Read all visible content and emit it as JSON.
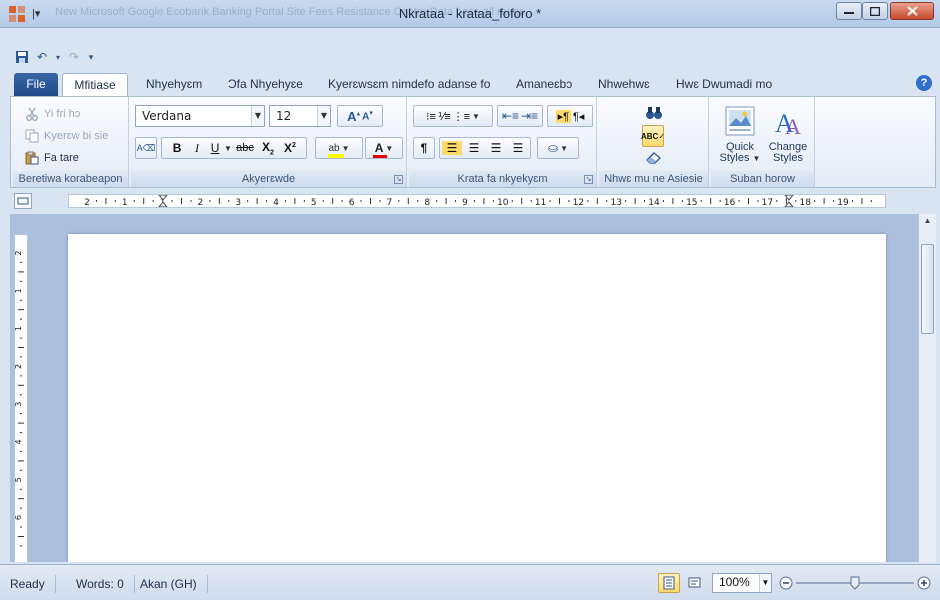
{
  "window": {
    "title": "Nkrataa - krataa_foforo *",
    "background_tabs": "New Microsoft    Google    Ecobank Banking Portal    Site Fees Resistance Centre    Data base all range"
  },
  "tabs": {
    "file": "File",
    "items": [
      "Mfitiase",
      "Nhyehyɛm",
      "Ɔfa Nhyehyɛe",
      "Kyerɛwsɛm nimdefo adanse fo",
      "Amaneɛbɔ",
      "Nhwehwɛ",
      "Hwɛ Dwumadi mo"
    ]
  },
  "clipboard": {
    "cut": "Yi fri hɔ",
    "copy": "Kyerɛw bi sie",
    "paste": "Fa tare",
    "label": "Beretiwa korabeapon"
  },
  "font": {
    "name": "Verdana",
    "size": "12",
    "label": "Akyerɛwde"
  },
  "paragraph": {
    "label": "Krata fa nkyekyɛm"
  },
  "editing": {
    "label": "Nhwɛ mu ne Asiesie"
  },
  "styles": {
    "quick_line1": "Quick",
    "quick_line2": "Styles",
    "change_line1": "Change",
    "change_line2": "Styles",
    "label": "Suban horow"
  },
  "ruler": {
    "horizontal_labels": [
      "2",
      "1",
      "1",
      "2",
      "3",
      "4",
      "5",
      "6",
      "7",
      "8",
      "9",
      "10",
      "11",
      "12",
      "13",
      "14",
      "15",
      "16",
      "17",
      "18",
      "19"
    ],
    "vertical_labels": [
      "2",
      "1",
      "1",
      "2",
      "3",
      "4",
      "5",
      "6"
    ]
  },
  "status": {
    "ready": "Ready",
    "words": "Words: 0",
    "language": "Akan (GH)",
    "zoom": "100%",
    "zoom_fraction": 0.5
  },
  "colors": {
    "accent": "#2b5797",
    "highlight": "#ffd96a",
    "font_color_bar": "#e00000",
    "highlighter_bar": "#ffff00"
  }
}
